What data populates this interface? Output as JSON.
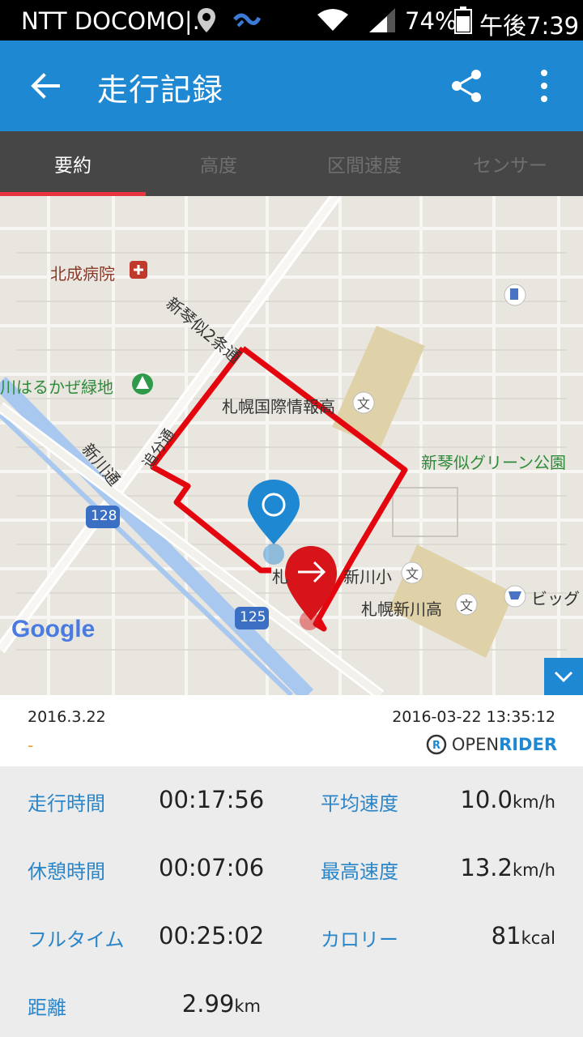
{
  "status": {
    "carrier": "NTT DOCOMO|.",
    "battery": "74%",
    "time": "午後7:39"
  },
  "app_bar": {
    "title": "走行記録"
  },
  "tabs": [
    {
      "label": "要約"
    },
    {
      "label": "高度"
    },
    {
      "label": "区間速度"
    },
    {
      "label": "センサー"
    }
  ],
  "map": {
    "labels": {
      "hospital": "北成病院",
      "street1": "新琴似2条通",
      "park1": "川はるかぜ緑地",
      "school1": "札幌国際情報高",
      "park2": "新琴似グリーン公園",
      "street2": "追分通",
      "street3": "新川通",
      "route128": "128",
      "route125": "125",
      "school2": "新川小",
      "school2_prefix": "札",
      "school3": "札幌新川高",
      "shop": "ビッグ",
      "google": "Google"
    },
    "colors": {
      "route": "#e4060f",
      "start_pin": "#1e88d2",
      "end_pin": "#d7141a"
    }
  },
  "info": {
    "date": "2016.3.22",
    "dash": "-",
    "datetime": "2016-03-22 13:35:12",
    "brand_open": "OPEN",
    "brand_rider": "RIDER"
  },
  "stats": {
    "ride_time_label": "走行時間",
    "ride_time": "00:17:56",
    "avg_speed_label": "平均速度",
    "avg_speed": "10.0",
    "avg_speed_unit": "km/h",
    "rest_time_label": "休憩時間",
    "rest_time": "00:07:06",
    "max_speed_label": "最高速度",
    "max_speed": "13.2",
    "max_speed_unit": "km/h",
    "full_time_label": "フルタイム",
    "full_time": "00:25:02",
    "calorie_label": "カロリー",
    "calorie": "81",
    "calorie_unit": "kcal",
    "distance_label": "距離",
    "distance": "2.99",
    "distance_unit": "km"
  }
}
